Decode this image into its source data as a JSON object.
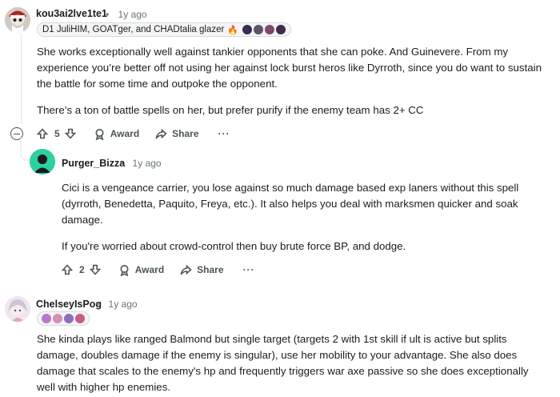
{
  "comments": [
    {
      "username": "kou3ai2lve1te1",
      "separator": "•",
      "time": "1y ago",
      "flair_text": "D1 JuliHIM, GOATger, and CHADtalia glazer",
      "flair_emoji": "🔥",
      "paragraphs": [
        "She works exceptionally well against tankier opponents that she can poke. And Guinevere. From my experience you’re better off not using her against lock burst heros like Dyrroth, since you do want to sustain the battle for some time and outpoke the opponent.",
        "There’s a ton of battle spells on her, but prefer purify if the enemy team has 2+ CC"
      ],
      "votes": "5",
      "award_label": "Award",
      "share_label": "Share",
      "more_label": "···"
    },
    {
      "username": "Purger_Bizza",
      "separator": "•",
      "time": "1y ago",
      "paragraphs": [
        "Cici is a vengeance carrier, you lose against so much damage based exp laners without this spell (dyrroth, Benedetta, Paquito, Freya, etc.). It also helps you deal with marksmen quicker and soak damage.",
        "If you're worried about crowd-control then buy brute force BP, and dodge."
      ],
      "votes": "2",
      "award_label": "Award",
      "share_label": "Share",
      "more_label": "···"
    },
    {
      "username": "ChelseyIsPog",
      "separator": "•",
      "time": "1y ago",
      "paragraphs": [
        "She kinda plays like ranged Balmond but single target (targets 2 with 1st skill if ult is active but splits damage, doubles damage if the enemy is singular), use her mobility to your advantage. She also does damage that scales to the enemy's hp and frequently triggers war axe passive so she does exceptionally well with higher hp enemies."
      ]
    }
  ],
  "colors": {
    "text": "#1c1c1c",
    "meta": "#6a7379",
    "icon": "#4b5458",
    "thread_line": "#e2e4e6",
    "avatar_purger": "#2fd0a0"
  }
}
